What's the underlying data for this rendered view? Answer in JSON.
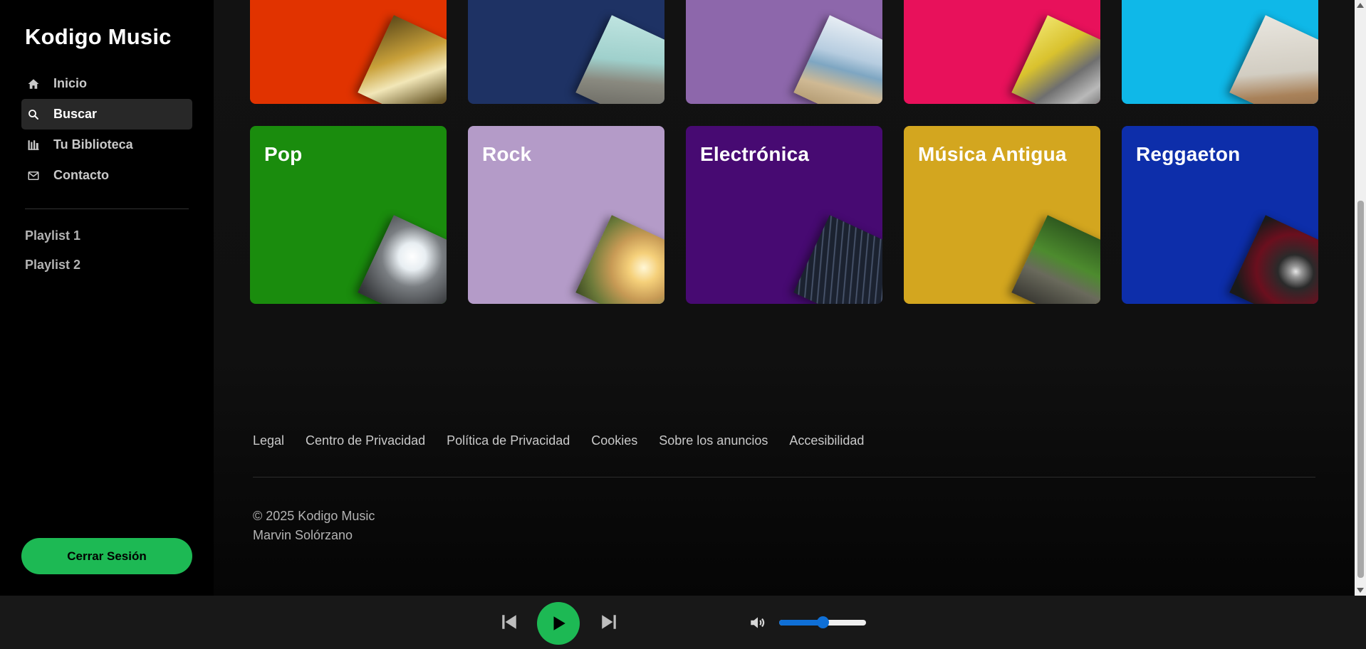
{
  "app": {
    "brand": "Kodigo Music"
  },
  "sidebar": {
    "nav": [
      {
        "label": "Inicio",
        "icon": "home-icon",
        "active": false
      },
      {
        "label": "Buscar",
        "icon": "search-icon",
        "active": true
      },
      {
        "label": "Tu Biblioteca",
        "icon": "library-icon",
        "active": false
      },
      {
        "label": "Contacto",
        "icon": "mail-icon",
        "active": false
      }
    ],
    "playlists": [
      "Playlist 1",
      "Playlist 2"
    ],
    "logout_label": "Cerrar Sesión"
  },
  "genres_top_row": [
    {
      "title": "",
      "color": "#e13300"
    },
    {
      "title": "",
      "color": "#1e3264"
    },
    {
      "title": "",
      "color": "#8d67ab"
    },
    {
      "title": "",
      "color": "#e8115b"
    },
    {
      "title": "",
      "color": "#0fb8e8"
    }
  ],
  "genres": [
    {
      "title": "Pop",
      "color": "#1a8c0d"
    },
    {
      "title": "Rock",
      "color": "#b49bc8"
    },
    {
      "title": "Electrónica",
      "color": "#470a72"
    },
    {
      "title": "Música Antigua",
      "color": "#d3a61f"
    },
    {
      "title": "Reggaeton",
      "color": "#0d2eaa"
    }
  ],
  "footer": {
    "links": [
      "Legal",
      "Centro de Privacidad",
      "Política de Privacidad",
      "Cookies",
      "Sobre los anuncios",
      "Accesibilidad"
    ],
    "copyright": "© 2025 Kodigo Music",
    "author": "Marvin Solórzano"
  },
  "player": {
    "volume": 0.5,
    "accent_color": "#1db954",
    "slider_color": "#0f6fd6"
  }
}
